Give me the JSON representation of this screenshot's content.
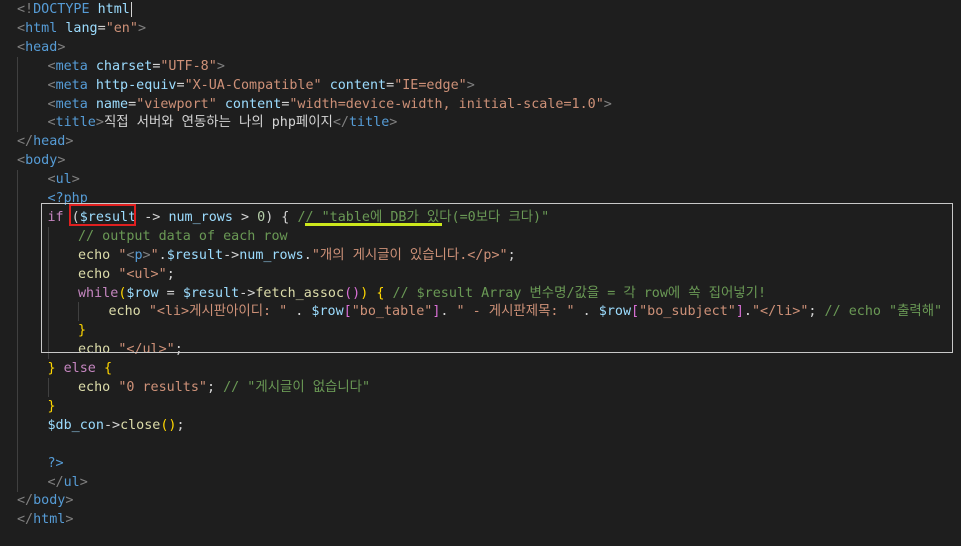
{
  "editor": {
    "language": "php",
    "theme_colors": {
      "background": "#1e1e1e",
      "tag": "#569cd6",
      "attribute": "#9cdcfe",
      "string": "#ce9178",
      "keyword": "#c586c0",
      "function": "#dcdcaa",
      "comment": "#6a9955",
      "annotation_red_box": "#e02020",
      "annotation_underline": "#cde81c"
    },
    "lines": [
      {
        "indent": 0,
        "tokens": [
          [
            "punct",
            "<!"
          ],
          [
            "tag",
            "DOCTYPE"
          ],
          [
            "text",
            " "
          ],
          [
            "attr",
            "html"
          ]
        ],
        "cursor": true
      },
      {
        "indent": 0,
        "tokens": [
          [
            "punct",
            "<"
          ],
          [
            "tag",
            "html"
          ],
          [
            "text",
            " "
          ],
          [
            "attr",
            "lang"
          ],
          [
            "text",
            "="
          ],
          [
            "str",
            "\"en\""
          ],
          [
            "punct",
            ">"
          ]
        ]
      },
      {
        "indent": 0,
        "tokens": [
          [
            "punct",
            "<"
          ],
          [
            "tag",
            "head"
          ],
          [
            "punct",
            ">"
          ]
        ]
      },
      {
        "indent": 1,
        "tokens": [
          [
            "punct",
            "<"
          ],
          [
            "tag",
            "meta"
          ],
          [
            "text",
            " "
          ],
          [
            "attr",
            "charset"
          ],
          [
            "text",
            "="
          ],
          [
            "str",
            "\"UTF-8\""
          ],
          [
            "punct",
            ">"
          ]
        ]
      },
      {
        "indent": 1,
        "tokens": [
          [
            "punct",
            "<"
          ],
          [
            "tag",
            "meta"
          ],
          [
            "text",
            " "
          ],
          [
            "attr",
            "http-equiv"
          ],
          [
            "text",
            "="
          ],
          [
            "str",
            "\"X-UA-Compatible\""
          ],
          [
            "text",
            " "
          ],
          [
            "attr",
            "content"
          ],
          [
            "text",
            "="
          ],
          [
            "str",
            "\"IE=edge\""
          ],
          [
            "punct",
            ">"
          ]
        ]
      },
      {
        "indent": 1,
        "tokens": [
          [
            "punct",
            "<"
          ],
          [
            "tag",
            "meta"
          ],
          [
            "text",
            " "
          ],
          [
            "attr",
            "name"
          ],
          [
            "text",
            "="
          ],
          [
            "str",
            "\"viewport\""
          ],
          [
            "text",
            " "
          ],
          [
            "attr",
            "content"
          ],
          [
            "text",
            "="
          ],
          [
            "str",
            "\"width=device-width, initial-scale=1.0\""
          ],
          [
            "punct",
            ">"
          ]
        ]
      },
      {
        "indent": 1,
        "tokens": [
          [
            "punct",
            "<"
          ],
          [
            "tag",
            "title"
          ],
          [
            "punct",
            ">"
          ],
          [
            "text",
            "직접 서버와 연동하는 나의 php페이지"
          ],
          [
            "punct",
            "</"
          ],
          [
            "tag",
            "title"
          ],
          [
            "punct",
            ">"
          ]
        ]
      },
      {
        "indent": 0,
        "tokens": [
          [
            "punct",
            "</"
          ],
          [
            "tag",
            "head"
          ],
          [
            "punct",
            ">"
          ]
        ]
      },
      {
        "indent": 0,
        "tokens": [
          [
            "punct",
            "<"
          ],
          [
            "tag",
            "body"
          ],
          [
            "punct",
            ">"
          ]
        ]
      },
      {
        "indent": 1,
        "tokens": [
          [
            "punct",
            "<"
          ],
          [
            "tag",
            "ul"
          ],
          [
            "punct",
            ">"
          ]
        ]
      },
      {
        "indent": 1,
        "tokens": [
          [
            "php",
            "<?php"
          ]
        ]
      },
      {
        "indent": 1,
        "tokens": [
          [
            "kw",
            "if"
          ],
          [
            "text",
            " ("
          ],
          [
            "var",
            "$result"
          ],
          [
            "text",
            " -> "
          ],
          [
            "var",
            "num_rows"
          ],
          [
            "text",
            " > "
          ],
          [
            "num",
            "0"
          ],
          [
            "text",
            ") { "
          ],
          [
            "cmt",
            "// \"table에 DB가 있다(=0보다 크다)\""
          ]
        ]
      },
      {
        "indent": 2,
        "tokens": [
          [
            "cmt",
            "// output data of each row"
          ]
        ]
      },
      {
        "indent": 2,
        "tokens": [
          [
            "func",
            "echo"
          ],
          [
            "text",
            " "
          ],
          [
            "str",
            "\""
          ],
          [
            "punct",
            "<"
          ],
          [
            "tag",
            "p"
          ],
          [
            "punct",
            ">"
          ],
          [
            "str",
            "\""
          ],
          [
            "text",
            "."
          ],
          [
            "var",
            "$result"
          ],
          [
            "text",
            "->"
          ],
          [
            "var",
            "num_rows"
          ],
          [
            "text",
            "."
          ],
          [
            "str",
            "\"개의 게시글이 있습니다.</p>\""
          ],
          [
            "text",
            ";"
          ]
        ]
      },
      {
        "indent": 2,
        "tokens": [
          [
            "func",
            "echo"
          ],
          [
            "text",
            " "
          ],
          [
            "str",
            "\"<ul>\""
          ],
          [
            "text",
            ";"
          ]
        ]
      },
      {
        "indent": 2,
        "tokens": [
          [
            "kw",
            "while"
          ],
          [
            "brace2",
            "("
          ],
          [
            "var",
            "$row"
          ],
          [
            "text",
            " = "
          ],
          [
            "var",
            "$result"
          ],
          [
            "text",
            "->"
          ],
          [
            "func",
            "fetch_assoc"
          ],
          [
            "brace",
            "()"
          ],
          [
            "brace2",
            ")"
          ],
          [
            "text",
            " "
          ],
          [
            "brace2",
            "{"
          ],
          [
            "text",
            " "
          ],
          [
            "cmt",
            "// $result Array 변수명/값을 = 각 row에 쏙 집어넣기!"
          ]
        ]
      },
      {
        "indent": 3,
        "tokens": [
          [
            "func",
            "echo"
          ],
          [
            "text",
            " "
          ],
          [
            "str",
            "\"<li>게시판아이디: \""
          ],
          [
            "text",
            " . "
          ],
          [
            "var",
            "$row"
          ],
          [
            "brace",
            "["
          ],
          [
            "str",
            "\"bo_table\""
          ],
          [
            "brace",
            "]"
          ],
          [
            "text",
            ". "
          ],
          [
            "str",
            "\" - 게시판제목: \""
          ],
          [
            "text",
            " . "
          ],
          [
            "var",
            "$row"
          ],
          [
            "brace",
            "["
          ],
          [
            "str",
            "\"bo_subject\""
          ],
          [
            "brace",
            "]"
          ],
          [
            "text",
            "."
          ],
          [
            "str",
            "\"</li>\""
          ],
          [
            "text",
            "; "
          ],
          [
            "cmt",
            "// echo \"출력해\""
          ]
        ]
      },
      {
        "indent": 2,
        "tokens": [
          [
            "brace2",
            "}"
          ]
        ]
      },
      {
        "indent": 2,
        "tokens": [
          [
            "func",
            "echo"
          ],
          [
            "text",
            " "
          ],
          [
            "str",
            "\"</ul>\""
          ],
          [
            "text",
            ";"
          ]
        ]
      },
      {
        "indent": 1,
        "tokens": [
          [
            "brace2",
            "}"
          ],
          [
            "text",
            " "
          ],
          [
            "kw",
            "else"
          ],
          [
            "text",
            " "
          ],
          [
            "brace2",
            "{"
          ]
        ]
      },
      {
        "indent": 2,
        "tokens": [
          [
            "func",
            "echo"
          ],
          [
            "text",
            " "
          ],
          [
            "str",
            "\"0 results\""
          ],
          [
            "text",
            "; "
          ],
          [
            "cmt",
            "// \"게시글이 없습니다\""
          ]
        ]
      },
      {
        "indent": 1,
        "tokens": [
          [
            "brace2",
            "}"
          ]
        ]
      },
      {
        "indent": 1,
        "tokens": [
          [
            "var",
            "$db_con"
          ],
          [
            "text",
            "->"
          ],
          [
            "func",
            "close"
          ],
          [
            "brace2",
            "()"
          ],
          [
            "text",
            ";"
          ]
        ]
      },
      {
        "indent": 1,
        "tokens": []
      },
      {
        "indent": 1,
        "tokens": [
          [
            "php",
            "?>"
          ]
        ]
      },
      {
        "indent": 1,
        "tokens": [
          [
            "punct",
            "</"
          ],
          [
            "tag",
            "ul"
          ],
          [
            "punct",
            ">"
          ]
        ]
      },
      {
        "indent": 0,
        "tokens": [
          [
            "punct",
            "</"
          ],
          [
            "tag",
            "body"
          ],
          [
            "punct",
            ">"
          ]
        ]
      },
      {
        "indent": 0,
        "tokens": [
          [
            "punct",
            "</"
          ],
          [
            "tag",
            "html"
          ],
          [
            "punct",
            ">"
          ]
        ]
      }
    ]
  }
}
